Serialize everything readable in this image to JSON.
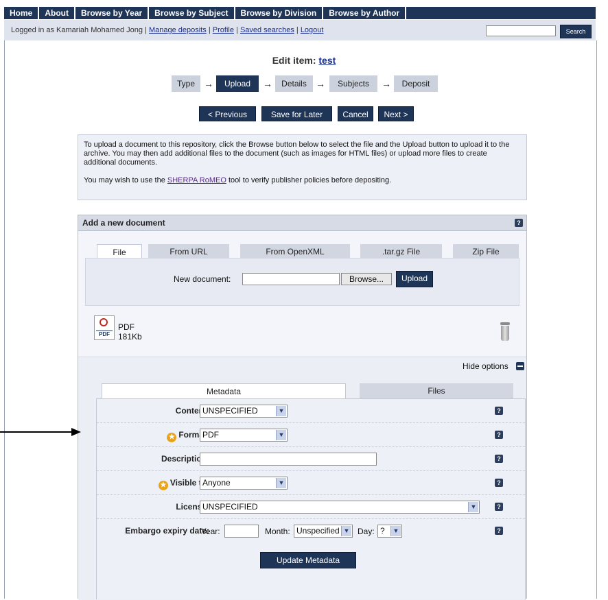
{
  "nav": {
    "items": [
      "Home",
      "About",
      "Browse by Year",
      "Browse by Subject",
      "Browse by Division",
      "Browse by Author"
    ]
  },
  "login": {
    "prefix": "Logged in as Kamariah Mohamed Jong |",
    "links": [
      "Manage deposits",
      "Profile",
      "Saved searches",
      "Logout"
    ],
    "search_button": "Search"
  },
  "edit": {
    "title_prefix": "Edit item:",
    "item_name": "test"
  },
  "stages": [
    {
      "label": "Type",
      "active": false
    },
    {
      "label": "Upload",
      "active": true
    },
    {
      "label": "Details",
      "active": false
    },
    {
      "label": "Subjects",
      "active": false
    },
    {
      "label": "Deposit",
      "active": false
    }
  ],
  "actions": {
    "previous": "< Previous",
    "save": "Save for Later",
    "cancel": "Cancel",
    "next": "Next >"
  },
  "info": {
    "paragraph1": "To upload a document to this repository, click the Browse button below to select the file and the Upload button to upload it to the archive. You may then add additional files to the document (such as images for HTML files) or upload more files to create additional documents.",
    "p2_before": "You may wish to use the",
    "p2_link": "SHERPA RoMEO",
    "p2_after": "tool to verify publisher policies before depositing."
  },
  "doc_panel": {
    "title": "Add a new document",
    "help": "?",
    "tabs": [
      "File",
      "From URL",
      "From OpenXML",
      ".tar.gz File",
      "Zip File"
    ],
    "new_document_label": "New document:",
    "browse": "Browse...",
    "upload": "Upload"
  },
  "file": {
    "type": "PDF",
    "size": "181Kb",
    "icon_text": "PDF",
    "hide_options": "Hide options"
  },
  "meta_tabs": [
    "Metadata",
    "Files"
  ],
  "fields": {
    "content_label": "Content:",
    "content_value": "UNSPECIFIED",
    "format_label": "Format:",
    "format_value": "PDF",
    "description_label": "Description:",
    "visible_label": "Visible to:",
    "visible_value": "Anyone",
    "license_label": "License:",
    "license_value": "UNSPECIFIED",
    "embargo_label": "Embargo expiry date:",
    "year_label": "Year:",
    "month_label": "Month:",
    "month_value": "Unspecified",
    "day_label": "Day:",
    "day_value": "?",
    "update_button": "Update Metadata"
  }
}
